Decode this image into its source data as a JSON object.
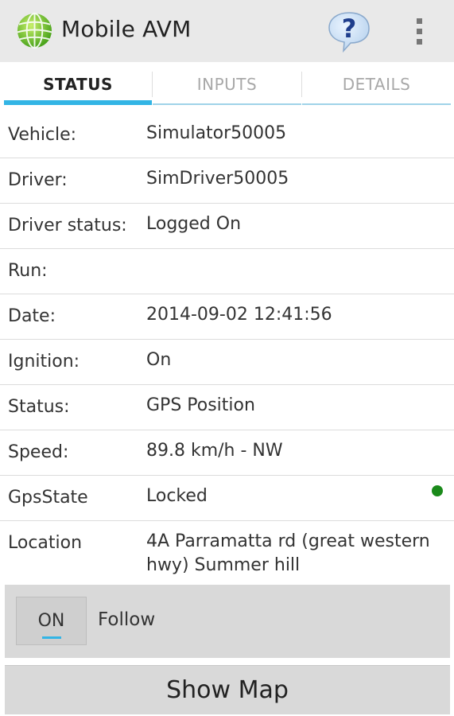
{
  "app": {
    "title": "Mobile AVM",
    "logo_icon": "globe-grid-icon",
    "help_icon": "help-question-bubble-icon",
    "overflow_icon": "overflow-menu-icon"
  },
  "tabs": [
    {
      "label": "STATUS",
      "active": true
    },
    {
      "label": "INPUTS",
      "active": false
    },
    {
      "label": "DETAILS",
      "active": false
    }
  ],
  "rows": [
    {
      "label": "Vehicle:",
      "value": "Simulator50005"
    },
    {
      "label": "Driver:",
      "value": "SimDriver50005"
    },
    {
      "label": "Driver status:",
      "value": "Logged On"
    },
    {
      "label": "Run:",
      "value": ""
    },
    {
      "label": "Date:",
      "value": "2014-09-02 12:41:56"
    },
    {
      "label": "Ignition:",
      "value": "On"
    },
    {
      "label": "Status:",
      "value": "GPS Position"
    },
    {
      "label": "Speed:",
      "value": "89.8 km/h - NW"
    },
    {
      "label": "GpsState",
      "value": "Locked",
      "indicator_color": "#1a8a1a"
    },
    {
      "label": "Location",
      "value": "4A Parramatta rd (great western hwy) Summer hill"
    }
  ],
  "follow": {
    "toggle_label": "ON",
    "label": "Follow"
  },
  "show_map": {
    "label": "Show Map"
  },
  "colors": {
    "accent": "#33b5e5",
    "actionbar": "#e9e9e9",
    "panel": "#d9d9d9"
  }
}
